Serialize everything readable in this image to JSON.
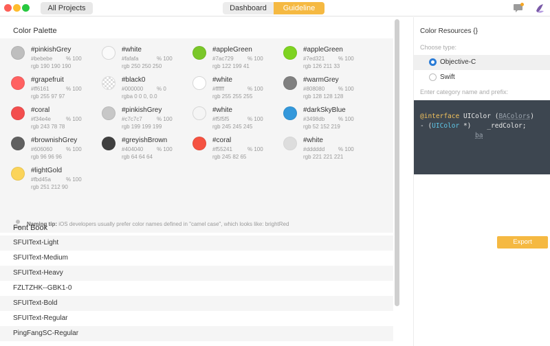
{
  "titlebar": {
    "all_projects": "All Projects",
    "tabs": [
      {
        "label": "Dashboard",
        "active": false
      },
      {
        "label": "Guideline",
        "active": true
      }
    ],
    "accent": "#f5b942"
  },
  "palette": {
    "title": "Color Palette",
    "swatches": [
      {
        "name": "#pinkishGrey",
        "hex": "#bebebe",
        "alpha": "% 100",
        "rgb": "rgb 190 190 190",
        "color": "#bebebe"
      },
      {
        "name": "#white",
        "hex": "#fafafa",
        "alpha": "% 100",
        "rgb": "rgb 250 250 250",
        "color": "#fafafa"
      },
      {
        "name": "#appleGreen",
        "hex": "#7ac729",
        "alpha": "% 100",
        "rgb": "rgb 122 199 41",
        "color": "#7ac729"
      },
      {
        "name": "#appleGreen",
        "hex": "#7ed321",
        "alpha": "% 100",
        "rgb": "rgb 126 211 33",
        "color": "#7ed321"
      },
      {
        "name": "#grapefruit",
        "hex": "#ff6161",
        "alpha": "% 100",
        "rgb": "rgb 255 97 97",
        "color": "#ff6161"
      },
      {
        "name": "#black0",
        "hex": "#000000",
        "alpha": "% 0",
        "rgb": "rgba 0 0 0, 0.0",
        "color": "transparent"
      },
      {
        "name": "#white",
        "hex": "#ffffff",
        "alpha": "% 100",
        "rgb": "rgb 255 255 255",
        "color": "#ffffff"
      },
      {
        "name": "#warmGrey",
        "hex": "#808080",
        "alpha": "% 100",
        "rgb": "rgb 128 128 128",
        "color": "#808080"
      },
      {
        "name": "#coral",
        "hex": "#f34e4e",
        "alpha": "% 100",
        "rgb": "rgb 243 78 78",
        "color": "#f34e4e"
      },
      {
        "name": "#pinkishGrey",
        "hex": "#c7c7c7",
        "alpha": "% 100",
        "rgb": "rgb 199 199 199",
        "color": "#c7c7c7"
      },
      {
        "name": "#white",
        "hex": "#f5f5f5",
        "alpha": "% 100",
        "rgb": "rgb 245 245 245",
        "color": "#f5f5f5"
      },
      {
        "name": "#darkSkyBlue",
        "hex": "#3498db",
        "alpha": "% 100",
        "rgb": "rgb 52 152 219",
        "color": "#3498db"
      },
      {
        "name": "#brownishGrey",
        "hex": "#606060",
        "alpha": "% 100",
        "rgb": "rgb 96 96 96",
        "color": "#606060"
      },
      {
        "name": "#greyishBrown",
        "hex": "#404040",
        "alpha": "% 100",
        "rgb": "rgb 64 64 64",
        "color": "#404040"
      },
      {
        "name": "#coral",
        "hex": "#f55241",
        "alpha": "% 100",
        "rgb": "rgb 245 82 65",
        "color": "#f55241"
      },
      {
        "name": "#white",
        "hex": "#dddddd",
        "alpha": "% 100",
        "rgb": "rgb 221 221 221",
        "color": "#dddddd"
      },
      {
        "name": "#lightGold",
        "hex": "#fbd45a",
        "alpha": "% 100",
        "rgb": "rgb 251 212 90",
        "color": "#fbd45a"
      }
    ],
    "tip_label": "Naming tip:",
    "tip_text": "iOS developers usually prefer color names defined in \"camel case\", which looks like: brightRed"
  },
  "fonts": {
    "title": "Font Book",
    "items": [
      "SFUIText-Light",
      "SFUIText-Medium",
      "SFUIText-Heavy",
      "FZLTZHK--GBK1-0",
      "SFUIText-Bold",
      "SFUIText-Regular",
      "PingFangSC-Regular"
    ]
  },
  "resources": {
    "title": "Color Resources {}",
    "choose_type": "Choose type:",
    "options": [
      {
        "label": "Objective-C",
        "selected": true
      },
      {
        "label": "Swift",
        "selected": false
      }
    ],
    "category_prompt": "Enter category name and prefix:",
    "code": {
      "kw_interface": "@interface",
      "class_name": "UIColor",
      "category_placeholder": "BAColors",
      "method_prefix": "- (",
      "return_type": "UIColor",
      "return_ptr": " *)",
      "method_name": "_redColor;",
      "prefix_placeholder": "ba"
    },
    "export_label": "Export"
  }
}
